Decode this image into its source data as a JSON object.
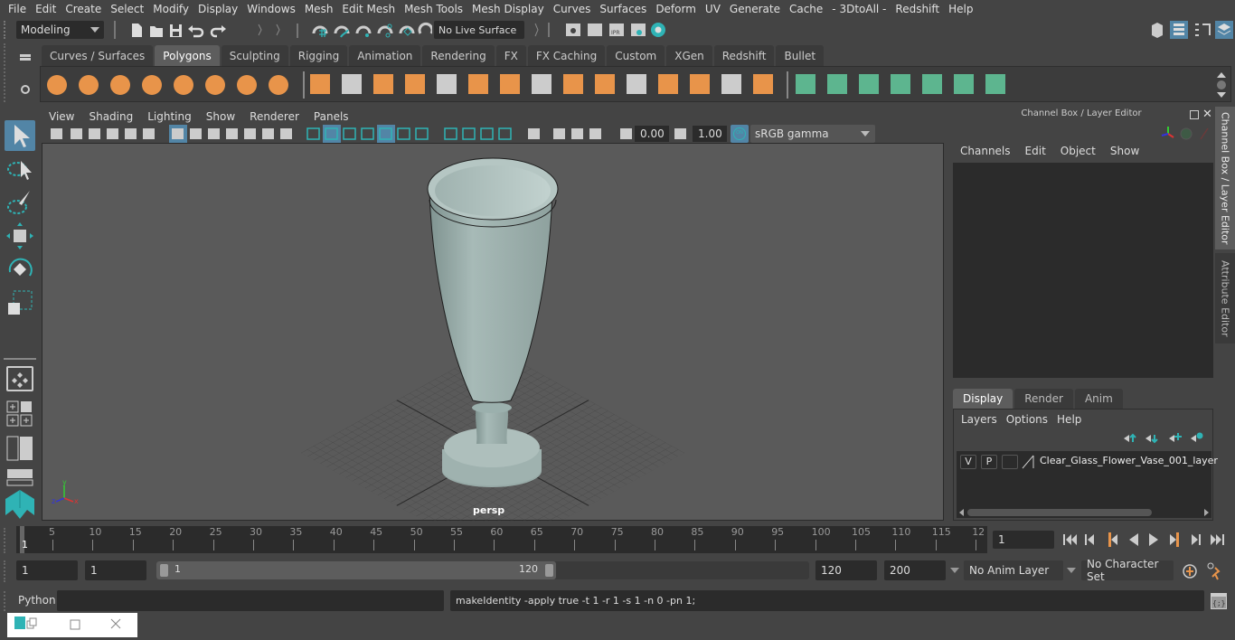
{
  "menubar": {
    "items": [
      "File",
      "Edit",
      "Create",
      "Select",
      "Modify",
      "Display",
      "Windows",
      "Mesh",
      "Edit Mesh",
      "Mesh Tools",
      "Mesh Display",
      "Curves",
      "Surfaces",
      "Deform",
      "UV",
      "Generate",
      "Cache",
      "- 3DtoAll -",
      "Redshift",
      "Help"
    ]
  },
  "status_line": {
    "mode": "Modeling",
    "live_surface": "No Live Surface"
  },
  "shelf": {
    "tabs": [
      "Curves / Surfaces",
      "Polygons",
      "Sculpting",
      "Rigging",
      "Animation",
      "Rendering",
      "FX",
      "FX Caching",
      "Custom",
      "XGen",
      "Redshift",
      "Bullet"
    ],
    "active_tab": "Polygons",
    "icons": [
      "poly-sphere-icon",
      "poly-cube-icon",
      "poly-cylinder-icon",
      "poly-cone-icon",
      "poly-plane-icon",
      "poly-torus-icon",
      "poly-pyramid-icon",
      "poly-pipe-icon",
      "combine-icon",
      "separate-icon",
      "mirror-icon",
      "smooth-icon",
      "extract-icon",
      "boolean-icon",
      "multi-cut-icon",
      "extrude-icon",
      "bridge-icon",
      "bevel-icon",
      "insert-edge-loop-icon",
      "offset-edge-loop-icon",
      "append-polygon-icon",
      "fill-hole-icon",
      "merge-icon",
      "planar-uv-icon",
      "cylindrical-uv-icon",
      "spherical-uv-icon",
      "automatic-uv-icon",
      "unfold-uv-icon",
      "uv-editor-icon",
      "sew-uv-icon"
    ]
  },
  "viewport": {
    "menu": [
      "View",
      "Shading",
      "Lighting",
      "Show",
      "Renderer",
      "Panels"
    ],
    "exposure": "0.00",
    "gamma": "1.00",
    "color_space": "sRGB gamma",
    "camera_label": "persp"
  },
  "channel_box": {
    "title": "Channel Box / Layer Editor",
    "menu": [
      "Channels",
      "Edit",
      "Object",
      "Show"
    ],
    "side_tabs": [
      "Channel Box / Layer Editor",
      "Attribute Editor"
    ]
  },
  "layer_editor": {
    "tabs": [
      "Display",
      "Render",
      "Anim"
    ],
    "active_tab": "Display",
    "menu": [
      "Layers",
      "Options",
      "Help"
    ],
    "layers": [
      {
        "visible": "V",
        "playback": "P",
        "name": "Clear_Glass_Flower_Vase_001_layer"
      }
    ]
  },
  "timeline": {
    "ticks": [
      5,
      10,
      15,
      20,
      25,
      30,
      35,
      40,
      45,
      50,
      55,
      60,
      65,
      70,
      75,
      80,
      85,
      90,
      95,
      100,
      105,
      110,
      115,
      "12"
    ],
    "current_frame_marker": "1",
    "current_frame": "1"
  },
  "range": {
    "start": "1",
    "playback_start": "1",
    "slider_start": "1",
    "slider_end": "120",
    "playback_end": "120",
    "end": "200",
    "anim_layer": "No Anim Layer",
    "character_set": "No Character Set"
  },
  "command_line": {
    "language": "Python",
    "input": "",
    "result": "makeIdentity -apply true -t 1 -r 1 -s 1 -n 0 -pn 1;"
  },
  "colors": {
    "accent_blue": "#5285a6",
    "shelf_orange": "#e8944a",
    "shelf_green": "#5db58f",
    "maya_teal": "#2fb3b5"
  }
}
